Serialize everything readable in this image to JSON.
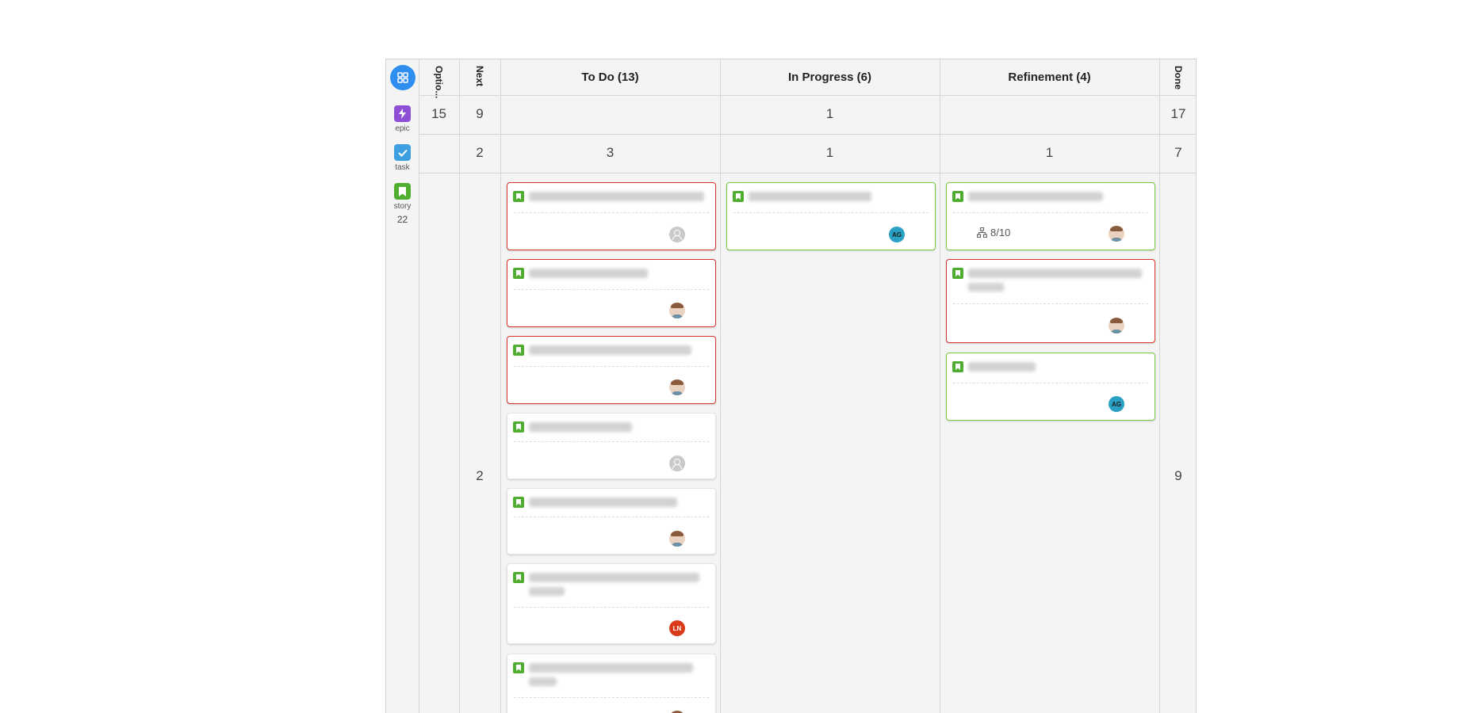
{
  "columns": [
    {
      "key": "options",
      "label": "Optio...",
      "vertical": true
    },
    {
      "key": "next",
      "label": "Next",
      "vertical": true
    },
    {
      "key": "todo",
      "label": "To Do  (13)",
      "vertical": false
    },
    {
      "key": "inprogress",
      "label": "In Progress  (6)",
      "vertical": false
    },
    {
      "key": "refinement",
      "label": "Refinement  (4)",
      "vertical": false
    },
    {
      "key": "done",
      "label": "Done",
      "vertical": true
    }
  ],
  "rows": [
    {
      "key": "epic",
      "label": "epic",
      "color": "#8e4fd6",
      "icon": "lightning-icon",
      "count": ""
    },
    {
      "key": "task",
      "label": "task",
      "color": "#3d9fe0",
      "icon": "checkmark-icon",
      "count": ""
    },
    {
      "key": "story",
      "label": "story",
      "color": "#4fad2f",
      "icon": "bookmark-icon",
      "count": "22"
    }
  ],
  "counts": {
    "epic": {
      "options": "15",
      "next": "9",
      "inprogress": "1",
      "done": "17"
    },
    "task": {
      "next": "2",
      "todo": "3",
      "inprogress": "1",
      "refinement": "1",
      "done": "7"
    },
    "story": {
      "next": "2",
      "done": "9"
    }
  },
  "cards": {
    "todo": [
      {
        "border": "red",
        "avatar": "empty"
      },
      {
        "border": "red",
        "avatar": "face"
      },
      {
        "border": "red",
        "avatar": "face"
      },
      {
        "border": "plain",
        "avatar": "empty"
      },
      {
        "border": "plain",
        "avatar": "face"
      },
      {
        "border": "plain",
        "avatar": "initials",
        "initials": "LN",
        "two_lines": true
      },
      {
        "border": "plain",
        "avatar": "face",
        "two_lines": true
      }
    ],
    "inprogress": [
      {
        "border": "green",
        "avatar": "initials",
        "initials": "AG"
      }
    ],
    "refinement": [
      {
        "border": "green",
        "avatar": "face",
        "progress": "8/10"
      },
      {
        "border": "red",
        "avatar": "face",
        "two_lines": true
      },
      {
        "border": "green",
        "avatar": "initials",
        "initials": "AG"
      }
    ]
  },
  "colors": {
    "accent": "#2e8ef0",
    "red_border": "#d9342b",
    "green_border": "#7ac943"
  },
  "header_icon": "grid-icon"
}
